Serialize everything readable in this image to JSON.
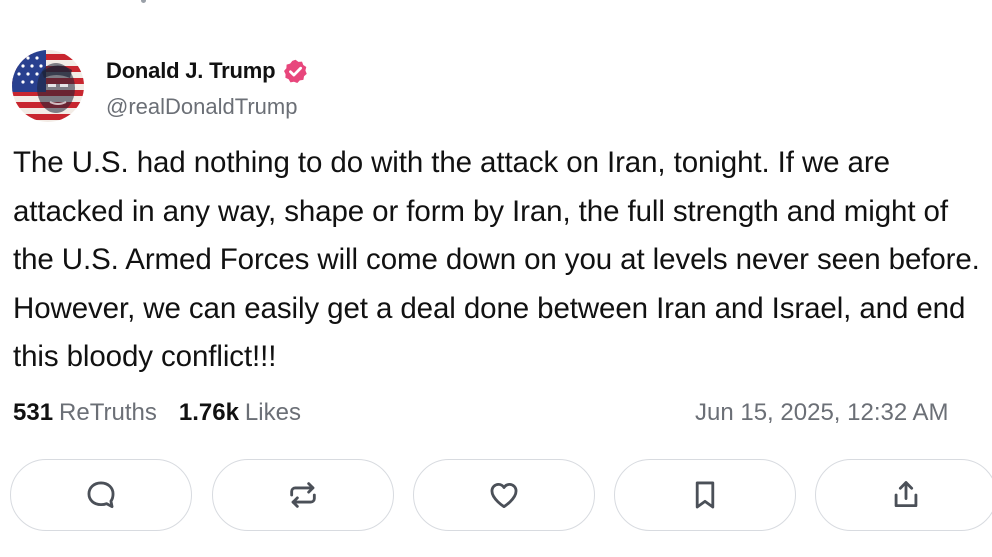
{
  "author": {
    "display_name": "Donald J. Trump",
    "handle": "@realDonaldTrump",
    "verified_icon": "verified-badge-icon",
    "verified_color": "#e8467c"
  },
  "post": {
    "text": "The U.S. had nothing to do with the attack on Iran, tonight. If we are attacked in any way, shape or form by Iran, the full strength and might of the U.S. Armed Forces will come down on you at levels never seen before. However, we can easily get a deal done between Iran and Israel, and end this bloody conflict!!!",
    "retruths_count": "531",
    "retruths_label": "ReTruths",
    "likes_count": "1.76k",
    "likes_label": "Likes",
    "timestamp": "Jun 15, 2025, 12:32 AM"
  },
  "actions": [
    {
      "name": "reply-button",
      "icon": "chat-bubble-icon"
    },
    {
      "name": "retruth-button",
      "icon": "repost-arrows-icon"
    },
    {
      "name": "like-button",
      "icon": "heart-icon"
    },
    {
      "name": "bookmark-button",
      "icon": "bookmark-icon"
    },
    {
      "name": "share-button",
      "icon": "share-icon"
    }
  ],
  "colors": {
    "text": "#111111",
    "muted": "#6b6f76",
    "border": "#d8dbe0",
    "icon": "#4b5058"
  }
}
